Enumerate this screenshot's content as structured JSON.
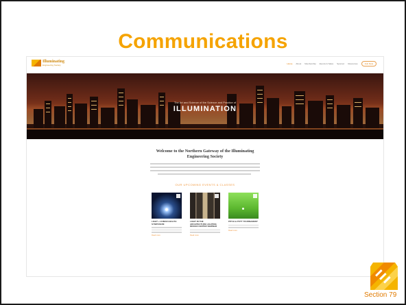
{
  "slide": {
    "title": "Communications",
    "section_label": "Section 79"
  },
  "website": {
    "logo": {
      "name": "Illuminating",
      "tagline": "Engineering Society"
    },
    "nav": {
      "items": [
        "Home",
        "About",
        "Membership",
        "Events & Sales",
        "Sponsor",
        "Resources"
      ],
      "button": "Join Now"
    },
    "hero": {
      "subtitle": "The Art and Science of the Science and Practice of",
      "title": "ILLUMINATION"
    },
    "welcome": {
      "line1": "Welcome to the Northern Gateway of the Illuminating",
      "line2": "Engineering Society"
    },
    "section_heading": "OUR UPCOMING EVENTS & CLASSES",
    "cards": [
      {
        "title": "LIGHT + HUMAN HEALTH SYMPOSIUM",
        "more": "Read more"
      },
      {
        "title": "LIGHT IN THE ARCHITECTURE LIGHTING DESIGN CENTER SEMINAR",
        "more": "Read more"
      },
      {
        "title": "PITCH & PUTT TOURNAMENT",
        "more": "Read more"
      }
    ]
  },
  "colors": {
    "accent": "#f5a300",
    "section": "#e07a00"
  }
}
